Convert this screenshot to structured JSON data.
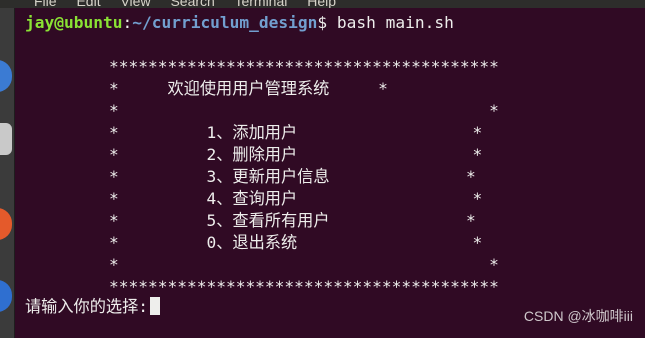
{
  "menubar": {
    "items": [
      "File",
      "Edit",
      "View",
      "Search",
      "Terminal",
      "Help"
    ]
  },
  "launcher": {
    "icons": [
      "browser-icon",
      "files-icon",
      "software-icon",
      "help-icon"
    ]
  },
  "terminal": {
    "prompt_user": "jay@ubuntu",
    "prompt_sep": ":",
    "prompt_path": "~/curriculum_design",
    "prompt_end": "$ ",
    "command": "bash main.sh",
    "menu_lines": [
      "****************************************",
      "*     欢迎使用用户管理系统     *",
      "*                                      *",
      "*         1、添加用户                  *",
      "*         2、删除用户                  *",
      "*         3、更新用户信息              *",
      "*         4、查询用户                  *",
      "*         5、查看所有用户              *",
      "*         0、退出系统                  *",
      "*                                      *",
      "****************************************"
    ],
    "input_prompt": "请输入你的选择:"
  },
  "watermark": "CSDN @冰咖啡iii"
}
